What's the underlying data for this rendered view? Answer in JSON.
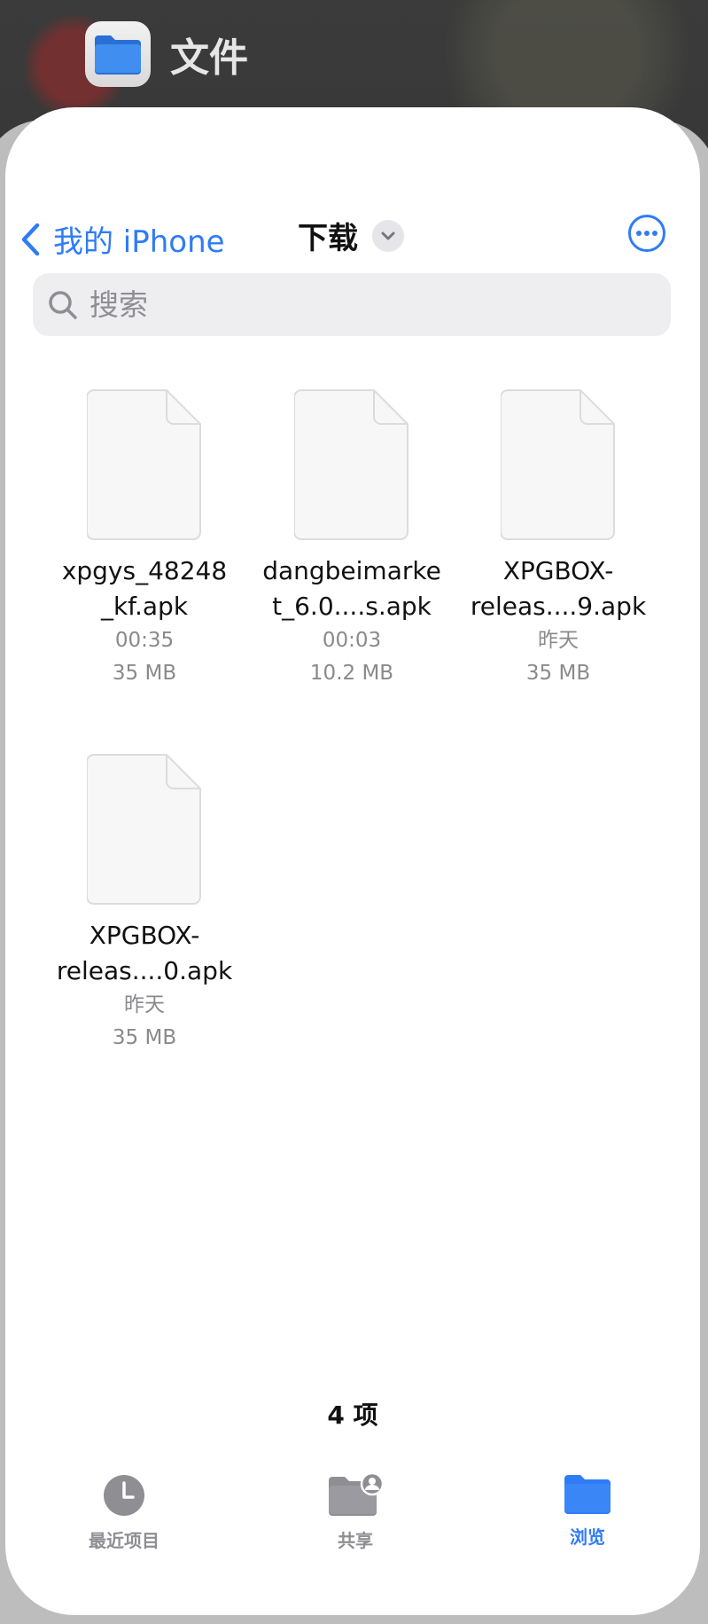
{
  "app_switcher": {
    "app_name": "文件"
  },
  "navbar": {
    "back_label": "我的 iPhone",
    "title": "下载"
  },
  "search": {
    "placeholder": "搜索"
  },
  "files": [
    {
      "name": "xpgys_48248_kf.apk",
      "name_lines": [
        "xpgys_48248",
        "_kf.apk"
      ],
      "time": "00:35",
      "size": "35 MB"
    },
    {
      "name": "dangbeimarket_6.0....s.apk",
      "name_lines": [
        "dangbeimarke",
        "t_6.0....s.apk"
      ],
      "time": "00:03",
      "size": "10.2 MB"
    },
    {
      "name": "XPGBOX-releas....9.apk",
      "name_lines": [
        "XPGBOX-",
        "releas....9.apk"
      ],
      "time": "昨天",
      "size": "35 MB"
    },
    {
      "name": "XPGBOX-releas....0.apk",
      "name_lines": [
        "XPGBOX-",
        "releas....0.apk"
      ],
      "time": "昨天",
      "size": "35 MB"
    }
  ],
  "item_count": "4 项",
  "tabbar": {
    "tabs": [
      {
        "label": "最近项目",
        "icon": "clock-icon",
        "active": false
      },
      {
        "label": "共享",
        "icon": "shared-folder-icon",
        "active": false
      },
      {
        "label": "浏览",
        "icon": "folder-icon",
        "active": true
      }
    ]
  },
  "colors": {
    "accent": "#2f7cf6",
    "secondary_text": "#8a8a8e",
    "search_bg": "#eeeef0"
  }
}
